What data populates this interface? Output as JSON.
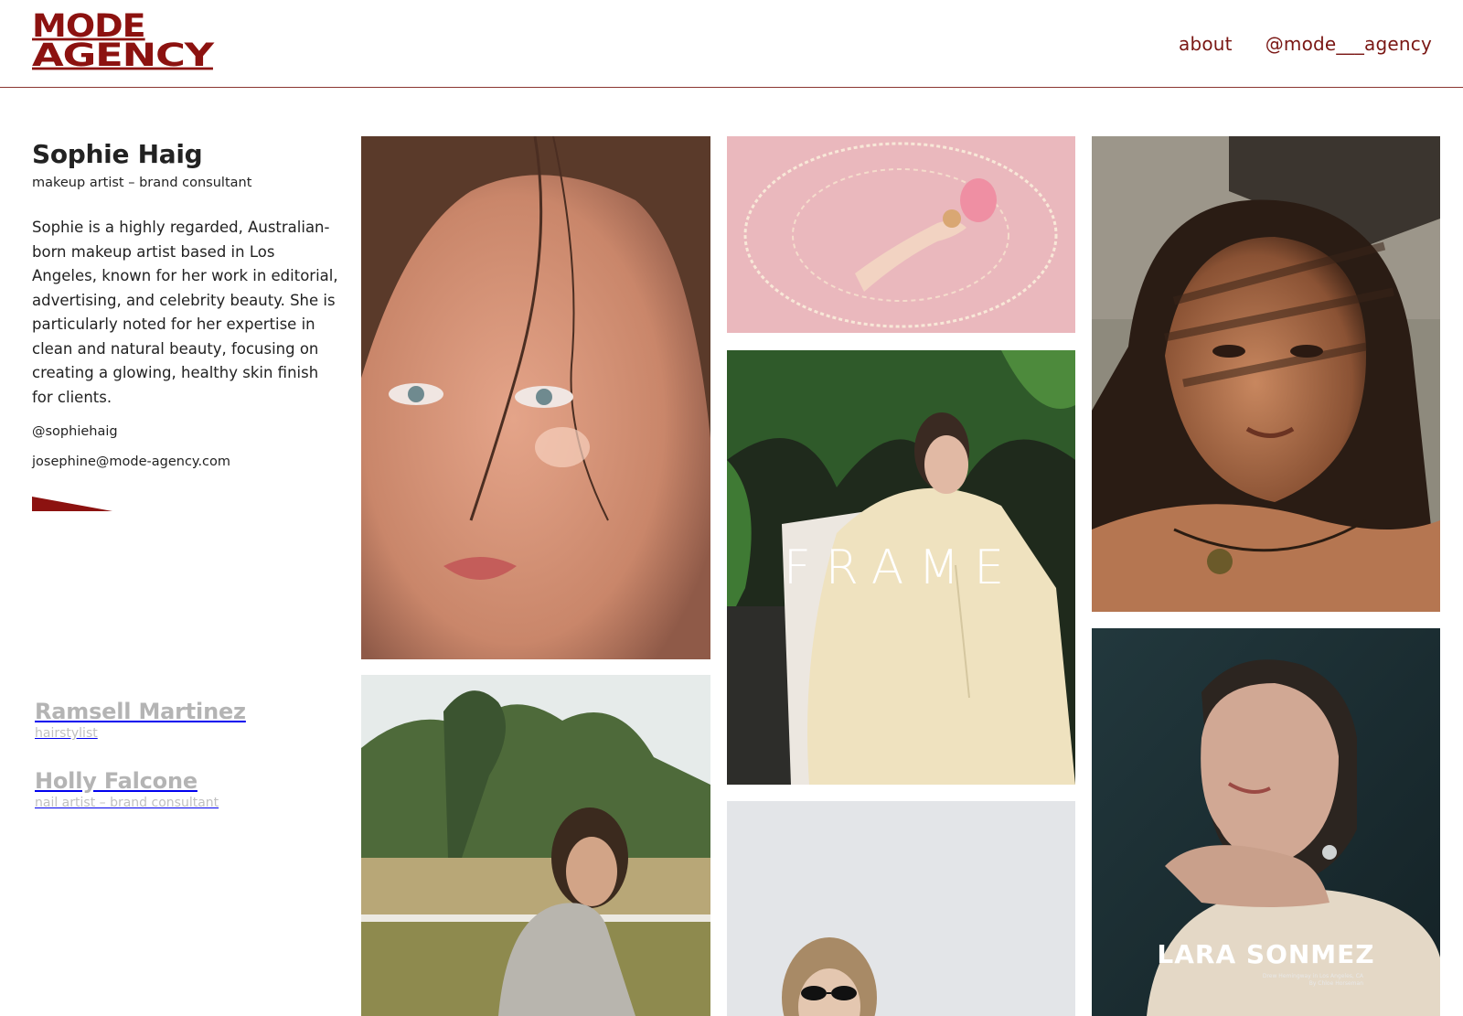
{
  "brand": {
    "logo_line1": "MODE",
    "logo_line2": "AGENCY",
    "color": "#8c1210"
  },
  "nav": {
    "about": "about",
    "instagram": "@mode___agency"
  },
  "artist": {
    "name": "Sophie Haig",
    "role": "makeup artist – brand consultant",
    "bio": "Sophie is a highly regarded, Australian-born makeup artist based in Los Angeles, known for her work in editorial, advertising, and celebrity beauty. She is particularly noted for her expertise in clean and natural beauty, focusing on creating a glowing, healthy skin finish for clients.",
    "instagram": "@sophiehaig",
    "email": "josephine@mode-agency.com"
  },
  "other_artists": [
    {
      "name": "Ramsell Martinez",
      "role": "hairstylist"
    },
    {
      "name": "Holly Falcone",
      "role": "nail artist – brand consultant"
    }
  ],
  "gallery": {
    "frame_text": "FRAME",
    "cover_title": "LARA SONMEZ",
    "cover_credit_1": "Drew Hemingway in Los Angeles, CA",
    "cover_credit_2": "By Chloe Horseman"
  },
  "colors": {
    "accent": "#8c1210",
    "nav_text": "#7a1714",
    "muted": "#b4b4b4"
  }
}
